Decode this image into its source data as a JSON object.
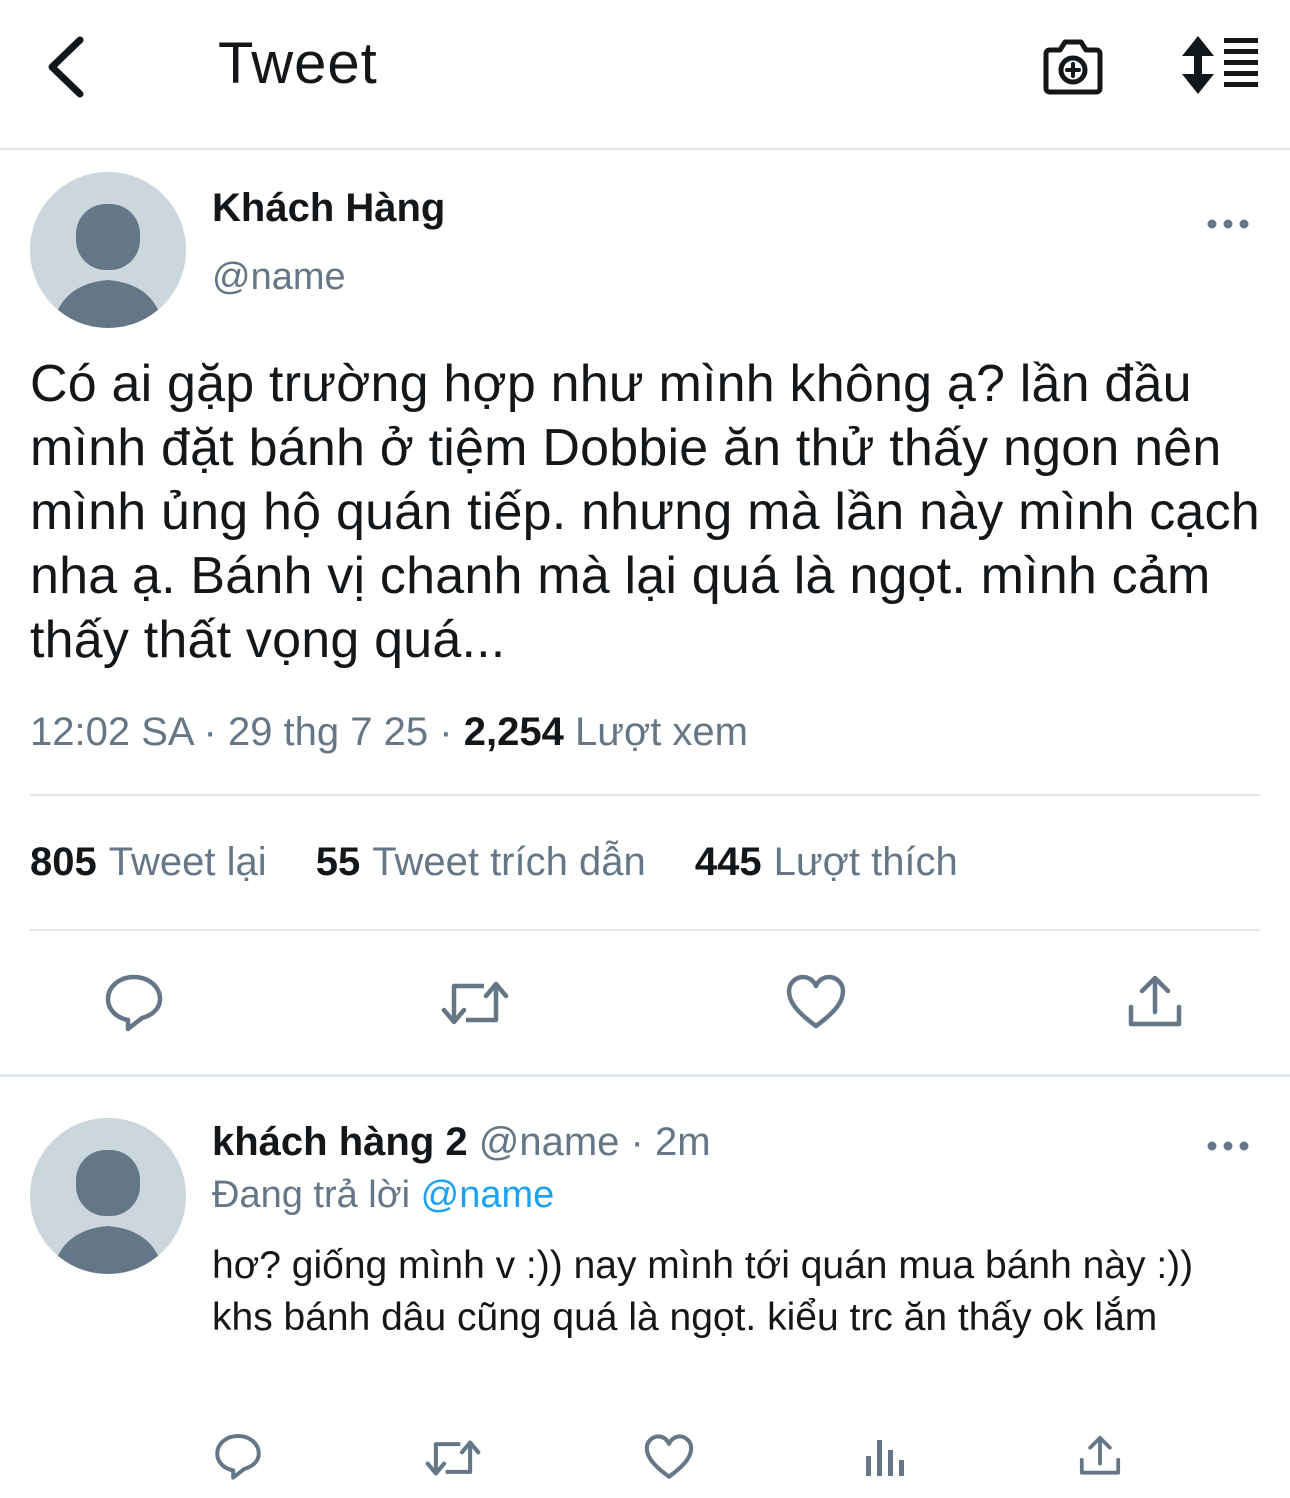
{
  "header": {
    "title": "Tweet",
    "back_icon": "chevron-left-icon",
    "camera_icon": "camera-plus-icon",
    "sort_icon": "sort-list-icon"
  },
  "tweet": {
    "author_name": "Khách Hàng",
    "author_handle": "@name",
    "text": "Có ai gặp trường hợp như mình không ạ? lần đầu mình đặt bánh ở tiệm Dobbie ăn thử thấy ngon nên mình ủng hộ quán tiếp. nhưng mà lần này mình cạch nha ạ. Bánh vị chanh mà lại quá là ngọt. mình cảm thấy thất vọng quá...",
    "time": "12:02 SA",
    "sep": "·",
    "date": "29 thg 7 25",
    "views_count": "2,254",
    "views_label": "Lượt xem",
    "stats": [
      {
        "count": "805",
        "label": "Tweet lại"
      },
      {
        "count": "55",
        "label": "Tweet trích dẫn"
      },
      {
        "count": "445",
        "label": "Lượt thích"
      }
    ]
  },
  "reply": {
    "author_name": "khách hàng 2",
    "author_handle": "@name",
    "sep": "·",
    "time": "2m",
    "replying_prefix": "Đang trả lời",
    "replying_to": "@name",
    "text": "hơ? giống mình v :)) nay mình tới quán mua bánh này :)) khs bánh dâu cũng quá là ngọt. kiểu trc ăn thấy ok lắm"
  },
  "colors": {
    "text": "#14171a",
    "secondary": "#657786",
    "link": "#1da1f2",
    "divider": "#e1e8ed",
    "avatar_bg": "#ccd6dd",
    "avatar_fg": "#657786"
  }
}
